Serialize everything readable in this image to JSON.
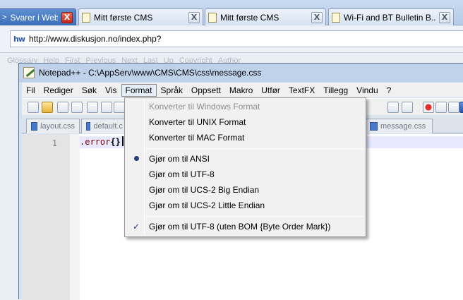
{
  "browser": {
    "tabs": [
      {
        "label": "Svarer i Webd...",
        "active": true
      },
      {
        "label": "Mitt første CMS",
        "active": false
      },
      {
        "label": "Mitt første CMS",
        "active": false
      },
      {
        "label": "Wi-Fi and BT Bulletin B...",
        "active": false
      }
    ],
    "close_glyph": "X",
    "url": "http://www.diskusjon.no/index.php?",
    "site_icon_text": "hw",
    "page_nav": [
      "Glossary",
      "Help",
      "First",
      "Previous",
      "Next",
      "Last",
      "Up",
      "Copyright",
      "Author"
    ]
  },
  "npp": {
    "title": "Notepad++ - C:\\AppServ\\www\\CMS\\CMS\\css\\message.css",
    "menu": [
      "Fil",
      "Rediger",
      "Søk",
      "Vis",
      "Format",
      "Språk",
      "Oppsett",
      "Makro",
      "Utfør",
      "TextFX",
      "Tillegg",
      "Vindu",
      "?"
    ],
    "open_menu": "Format",
    "file_tabs": [
      "layout.css",
      "default.c",
      "message.css"
    ],
    "active_file": "message.css",
    "line_number": "1",
    "code": {
      "selector": ".error",
      "braces": "{}"
    }
  },
  "format_menu": {
    "items": [
      {
        "label": "Konverter til Windows Format",
        "disabled": true,
        "mark": ""
      },
      {
        "label": "Konverter til UNIX Format",
        "disabled": false,
        "mark": ""
      },
      {
        "label": "Konverter til MAC Format",
        "disabled": false,
        "mark": ""
      },
      {
        "label": "Gjør om til ANSI",
        "disabled": false,
        "mark": "radio"
      },
      {
        "label": "Gjør om til UTF-8",
        "disabled": false,
        "mark": ""
      },
      {
        "label": "Gjør om til UCS-2 Big Endian",
        "disabled": false,
        "mark": ""
      },
      {
        "label": "Gjør om til UCS-2 Little Endian",
        "disabled": false,
        "mark": ""
      },
      {
        "label": "Gjør om til UTF-8 (uten BOM {Byte Order Mark})",
        "disabled": false,
        "mark": "check"
      }
    ],
    "check_glyph": "✓"
  }
}
